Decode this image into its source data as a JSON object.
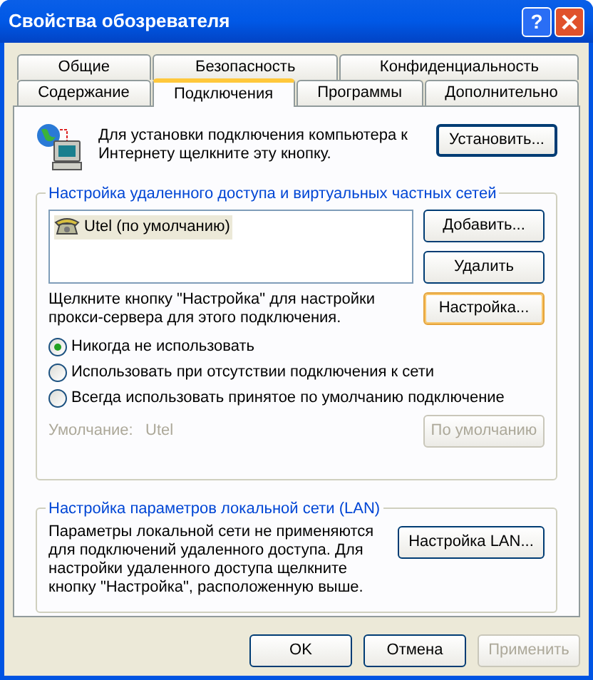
{
  "window": {
    "title": "Свойства обозревателя",
    "help_label": "?"
  },
  "tab_rows": [
    {
      "tabs": [
        {
          "label": "Общие",
          "selected": false
        },
        {
          "label": "Безопасность",
          "selected": false
        },
        {
          "label": "Конфиденциальность",
          "selected": false
        }
      ]
    },
    {
      "tabs": [
        {
          "label": "Содержание",
          "selected": false
        },
        {
          "label": "Подключения",
          "selected": true
        },
        {
          "label": "Программы",
          "selected": false
        },
        {
          "label": "Дополнительно",
          "selected": false
        }
      ]
    }
  ],
  "setup": {
    "text": "Для установки подключения компьютера к Интернету щелкните эту кнопку.",
    "button": "Установить..."
  },
  "dialup": {
    "legend": "Настройка удаленного доступа и виртуальных частных сетей",
    "connections": [
      {
        "name": "Utel (по умолчанию)",
        "selected": true
      }
    ],
    "buttons": [
      {
        "label": "Добавить...",
        "highlighted": false
      },
      {
        "label": "Удалить",
        "highlighted": false
      },
      {
        "label": "Настройка...",
        "highlighted": true
      }
    ],
    "proxy_text": "Щелкните кнопку \"Настройка\" для настройки прокси-сервера для этого подключения.",
    "options": [
      {
        "label": "Никогда не использовать",
        "selected": true
      },
      {
        "label": "Использовать при отсутствии подключения к сети",
        "selected": false
      },
      {
        "label": "Всегда использовать принятое по умолчанию подключение",
        "selected": false
      }
    ],
    "default_label": "Умолчание:",
    "default_value": "Utel",
    "default_button": {
      "label": "По умолчанию",
      "disabled": true
    }
  },
  "lan": {
    "legend": "Настройка параметров локальной сети (LAN)",
    "text": "Параметры локальной сети не применяются для подключений удаленного доступа. Для настройки удаленного доступа щелкните кнопку \"Настройка\", расположенную выше.",
    "button": "Настройка LAN..."
  },
  "footer_buttons": [
    {
      "label": "OK",
      "disabled": false
    },
    {
      "label": "Отмена",
      "disabled": false
    },
    {
      "label": "Применить",
      "disabled": true
    }
  ]
}
